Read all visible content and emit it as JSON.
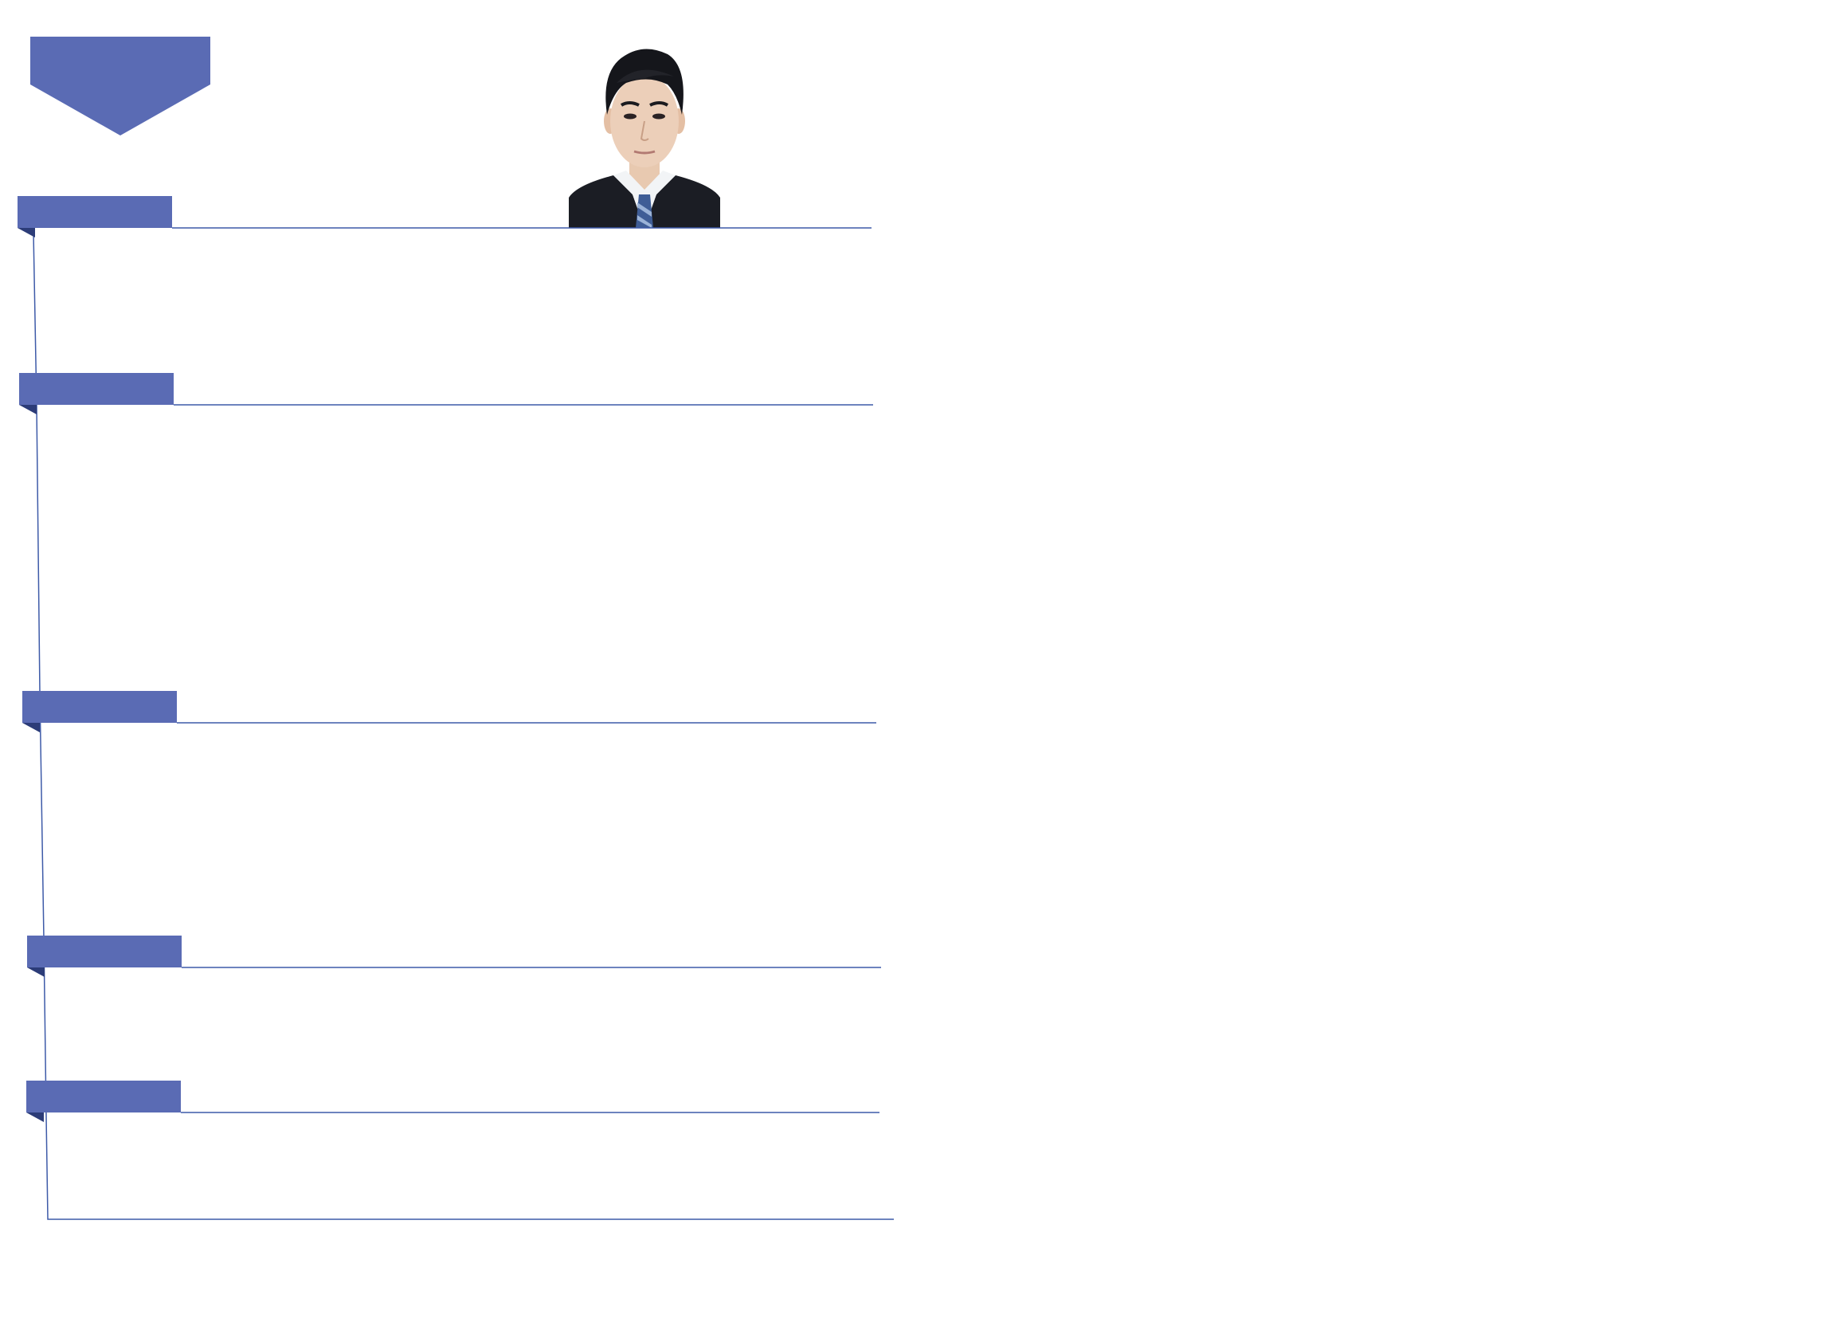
{
  "resume": {
    "accent_color": "#5a6bb4",
    "line_color": "#3d5aa8",
    "photo": {
      "icon": "portrait-photo",
      "description_visible": false
    },
    "sections": [
      {
        "title": "",
        "body": ""
      },
      {
        "title": "",
        "body": ""
      },
      {
        "title": "",
        "body": ""
      },
      {
        "title": "",
        "body": ""
      },
      {
        "title": "",
        "body": ""
      }
    ]
  }
}
